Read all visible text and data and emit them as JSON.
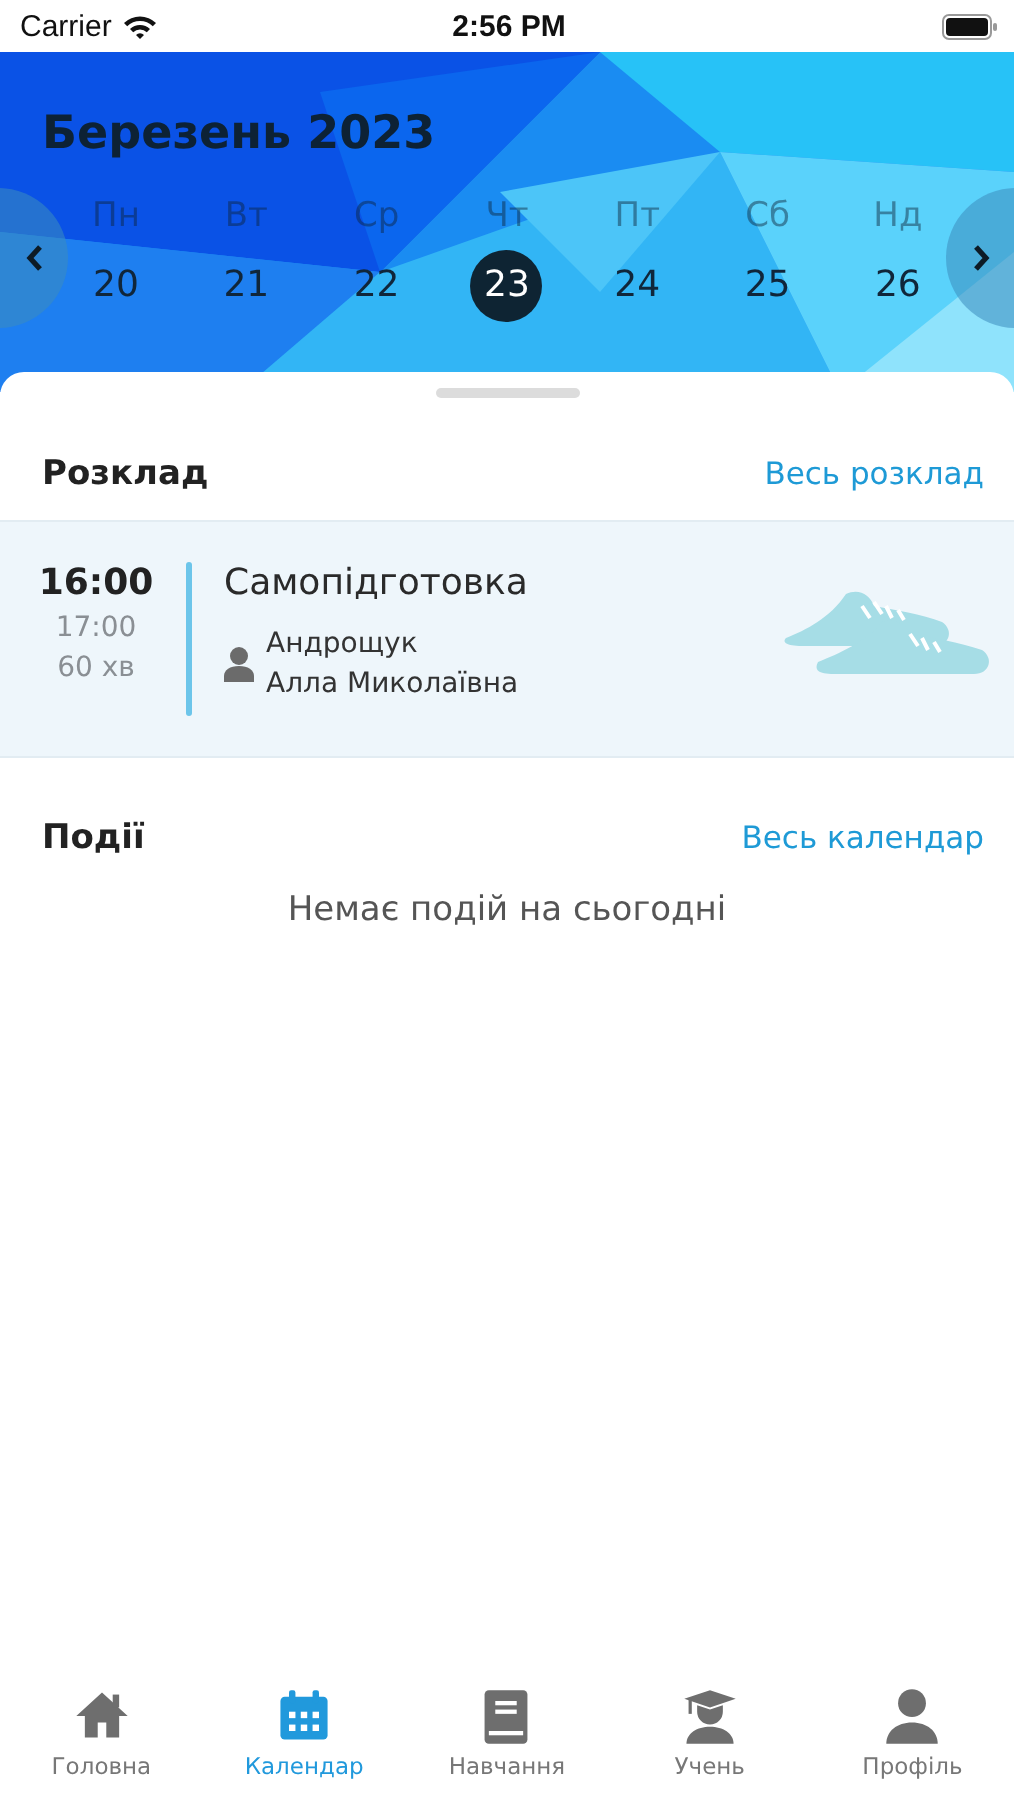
{
  "status_bar": {
    "carrier": "Carrier",
    "time": "2:56 PM"
  },
  "calendar": {
    "month": "Березень 2023",
    "days": [
      {
        "weekday": "Пн",
        "date": "20",
        "selected": false
      },
      {
        "weekday": "Вт",
        "date": "21",
        "selected": false
      },
      {
        "weekday": "Ср",
        "date": "22",
        "selected": false
      },
      {
        "weekday": "Чт",
        "date": "23",
        "selected": true
      },
      {
        "weekday": "Пт",
        "date": "24",
        "selected": false
      },
      {
        "weekday": "Сб",
        "date": "25",
        "selected": false
      },
      {
        "weekday": "Нд",
        "date": "26",
        "selected": false
      }
    ]
  },
  "schedule": {
    "title": "Розклад",
    "link": "Весь розклад",
    "lessons": [
      {
        "start": "16:00",
        "end": "17:00",
        "duration": "60 хв",
        "name": "Самопідготовка",
        "teacher_lines": [
          "Андрощук",
          "Алла Миколаївна"
        ]
      }
    ]
  },
  "events": {
    "title": "Події",
    "link": "Весь календар",
    "empty_text": "Немає подій на сьогодні"
  },
  "tab_bar": [
    {
      "label": "Головна",
      "kind": "home",
      "selected": false
    },
    {
      "label": "Календар",
      "kind": "calendar",
      "selected": true
    },
    {
      "label": "Навчання",
      "kind": "book",
      "selected": false
    },
    {
      "label": "Учень",
      "kind": "student",
      "selected": false
    },
    {
      "label": "Профіль",
      "kind": "person",
      "selected": false
    }
  ]
}
